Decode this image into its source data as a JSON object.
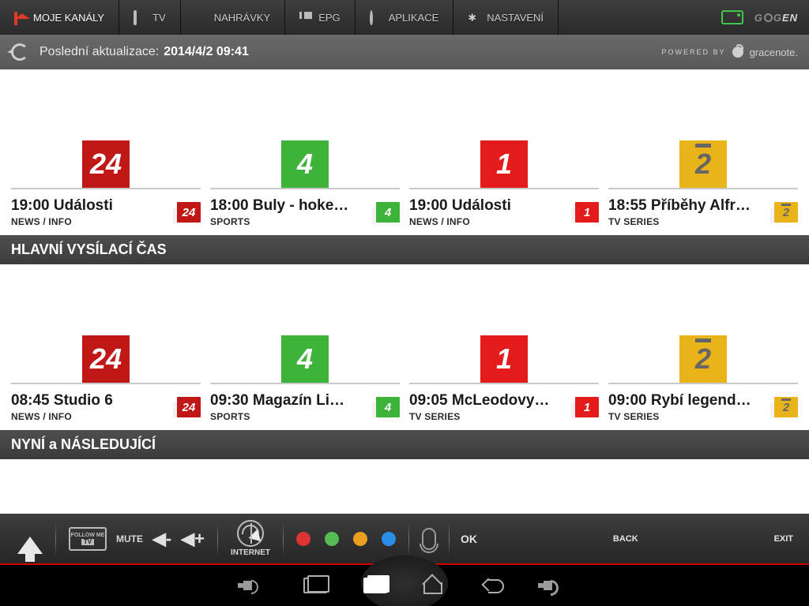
{
  "nav": {
    "items": [
      {
        "label": "MOJE KANÁLY",
        "icon": "home"
      },
      {
        "label": "TV",
        "icon": "tv"
      },
      {
        "label": "NAHRÁVKY",
        "icon": "dot"
      },
      {
        "label": "EPG",
        "icon": "list"
      },
      {
        "label": "APLIKACE",
        "icon": "app"
      },
      {
        "label": "NASTAVENÍ",
        "icon": "gear"
      }
    ],
    "brand": "GoGEN"
  },
  "subheader": {
    "label": "Poslední aktualizace:",
    "timestamp": "2014/4/2 09:41",
    "powered_by": "POWERED BY",
    "provider": "gracenote."
  },
  "sections": [
    {
      "header": null,
      "items": [
        {
          "logo": "24",
          "logo_color": "red",
          "mini_color": "red",
          "time": "19:00",
          "title": "Události",
          "genre": "NEWS / INFO"
        },
        {
          "logo": "4",
          "logo_color": "green",
          "mini_color": "green",
          "time": "18:00",
          "title": "Buly - hoke…",
          "genre": "SPORTS"
        },
        {
          "logo": "1",
          "logo_color": "red2",
          "mini_color": "red2",
          "time": "19:00",
          "title": "Události",
          "genre": "NEWS / INFO"
        },
        {
          "logo": "2",
          "logo_color": "yellow",
          "mini_color": "yellow",
          "time": "18:55",
          "title": "Příběhy Alfr…",
          "genre": "TV SERIES"
        }
      ]
    },
    {
      "header": "HLAVNÍ VYSÍLACÍ ČAS",
      "items": [
        {
          "logo": "24",
          "logo_color": "red",
          "mini_color": "red",
          "time": "08:45",
          "title": "Studio 6",
          "genre": "NEWS / INFO"
        },
        {
          "logo": "4",
          "logo_color": "green",
          "mini_color": "green",
          "time": "09:30",
          "title": "Magazín Li…",
          "genre": "SPORTS"
        },
        {
          "logo": "1",
          "logo_color": "red2",
          "mini_color": "red2",
          "time": "09:05",
          "title": "McLeodovy…",
          "genre": "TV SERIES"
        },
        {
          "logo": "2",
          "logo_color": "yellow",
          "mini_color": "yellow",
          "time": "09:00",
          "title": "Rybí legend…",
          "genre": "TV SERIES"
        }
      ]
    },
    {
      "header": "NYNÍ a NÁSLEDUJÍCÍ",
      "items": []
    }
  ],
  "remote": {
    "follow": "FOLLOW ME",
    "follow_tv": "TV",
    "mute": "MUTE",
    "vol_down": "-",
    "vol_up": "+",
    "internet": "INTERNET",
    "ok": "OK",
    "back": "BACK",
    "exit": "EXIT",
    "color_buttons": [
      "#d33",
      "#5b5",
      "#e9a020",
      "#2a8de8"
    ]
  }
}
